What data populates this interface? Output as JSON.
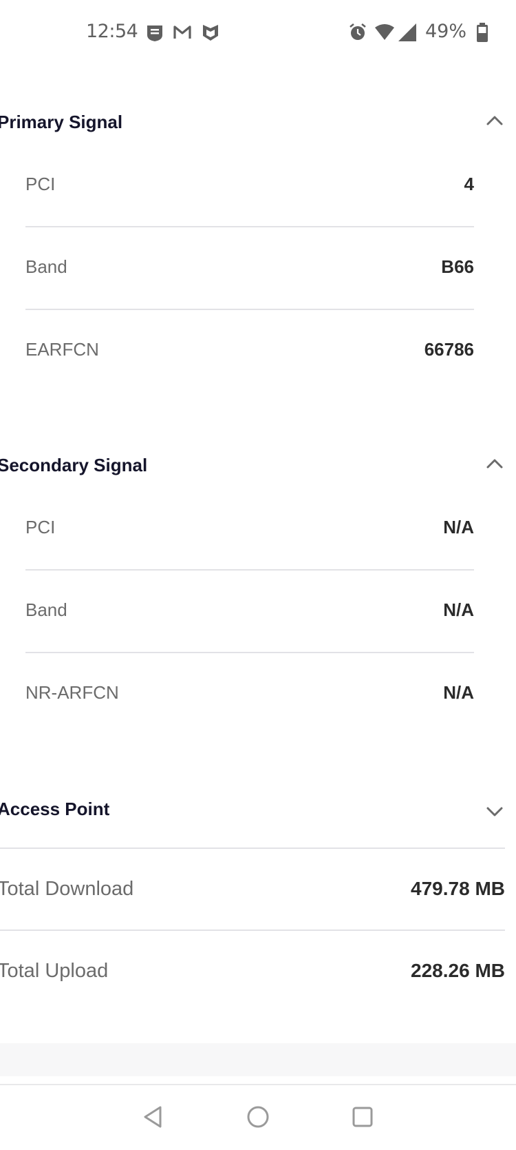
{
  "status_bar": {
    "time": "12:54",
    "notification_icons": [
      "news-icon",
      "gmail-icon",
      "mcafee-icon"
    ],
    "system_icons": [
      "alarm-icon",
      "wifi-icon",
      "cell-signal-icon"
    ],
    "battery_percent": "49%"
  },
  "primary": {
    "title": "Primary Signal",
    "expanded": true,
    "rows": [
      {
        "label": "PCI",
        "value": "4"
      },
      {
        "label": "Band",
        "value": "B66"
      },
      {
        "label": "EARFCN",
        "value": "66786"
      }
    ]
  },
  "secondary": {
    "title": "Secondary Signal",
    "expanded": true,
    "rows": [
      {
        "label": "PCI",
        "value": "N/A"
      },
      {
        "label": "Band",
        "value": "N/A"
      },
      {
        "label": "NR-ARFCN",
        "value": "N/A"
      }
    ]
  },
  "access_point": {
    "title": "Access Point",
    "expanded": false
  },
  "totals": {
    "download_label": "Total Download",
    "download_value": "479.78 MB",
    "upload_label": "Total Upload",
    "upload_value": "228.26 MB"
  },
  "nav_bar": {
    "buttons": [
      "back-icon",
      "home-icon",
      "recents-icon"
    ]
  },
  "colors": {
    "title_text": "#15152b",
    "label_text": "#6b6b6b",
    "value_text": "#2b2b2b",
    "divider": "#e2e2e6"
  }
}
